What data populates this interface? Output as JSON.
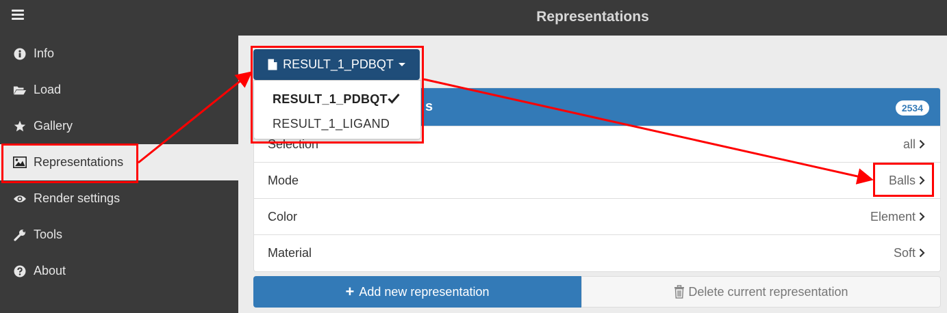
{
  "header": {
    "title": "Representations"
  },
  "sidebar": {
    "items": [
      {
        "label": "Info",
        "icon": "info-circle-icon"
      },
      {
        "label": "Load",
        "icon": "folder-open-icon"
      },
      {
        "label": "Gallery",
        "icon": "star-icon"
      },
      {
        "label": "Representations",
        "icon": "image-icon",
        "active": true
      },
      {
        "label": "Render settings",
        "icon": "eye-icon"
      },
      {
        "label": "Tools",
        "icon": "wrench-icon"
      },
      {
        "label": "About",
        "icon": "question-circle-icon"
      }
    ]
  },
  "dropdown": {
    "selected_label": "RESULT_1_PDBQT",
    "options": [
      {
        "label": "RESULT_1_PDBQT",
        "checked": true
      },
      {
        "label": "RESULT_1_LIGAND",
        "checked": false
      }
    ]
  },
  "panel": {
    "header_suffix": "s",
    "badge": "2534",
    "rows": [
      {
        "label": "Selection",
        "value": "all"
      },
      {
        "label": "Mode",
        "value": "Balls"
      },
      {
        "label": "Color",
        "value": "Element"
      },
      {
        "label": "Material",
        "value": "Soft"
      }
    ]
  },
  "actions": {
    "add_label": "Add new representation",
    "delete_label": "Delete current representation"
  },
  "colors": {
    "annotation": "#ff0000",
    "primary": "#337ab7",
    "dropdown_button": "#1f4d79",
    "sidebar_bg": "#3a3a3a"
  }
}
